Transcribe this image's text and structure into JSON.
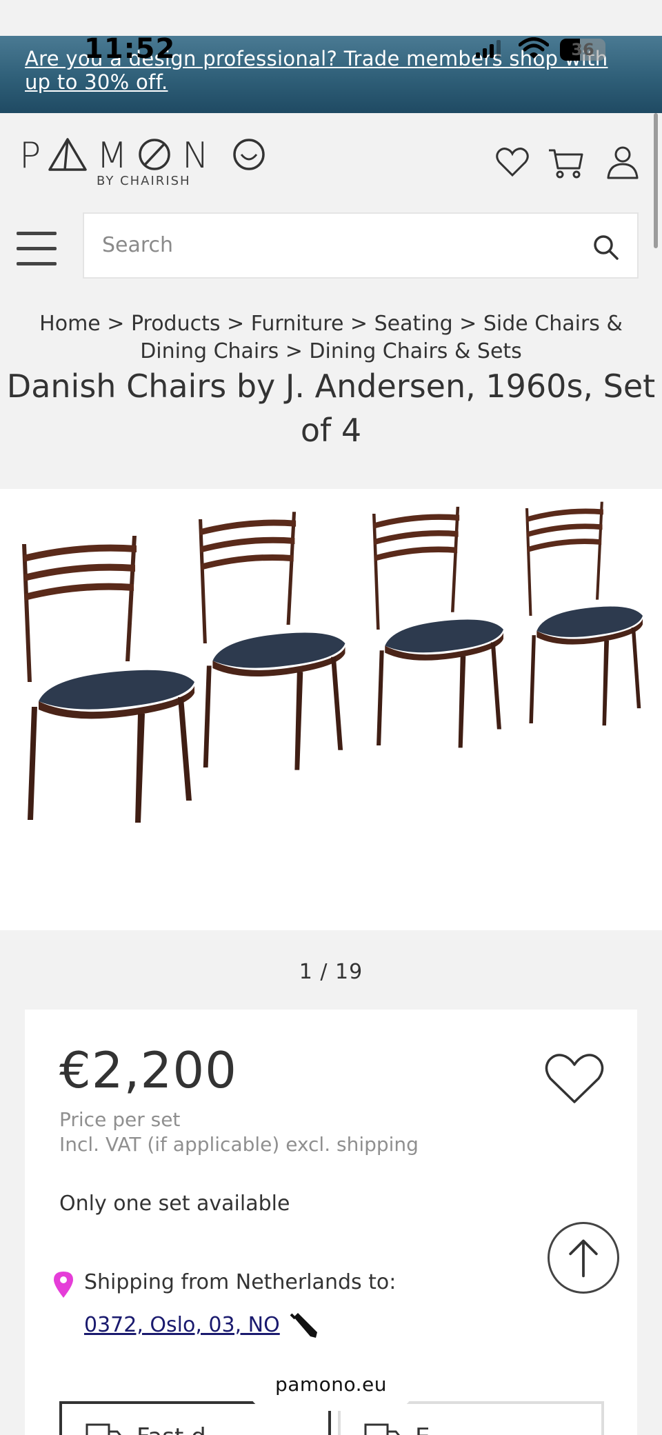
{
  "status_bar": {
    "time": "11:52",
    "battery": "36"
  },
  "banner": {
    "text": "Are you a design professional? Trade members shop with up to 30% off."
  },
  "header": {
    "logo_text": "PAMONO",
    "logo_sub": "BY CHAIRISH",
    "icons": [
      "heart-icon",
      "cart-icon",
      "user-icon"
    ]
  },
  "search": {
    "placeholder": "Search"
  },
  "breadcrumb": "Home > Products > Furniture > Seating > Side Chairs & Dining Chairs > Dining Chairs & Sets",
  "product": {
    "title": "Danish Chairs by J. Andersen, 1960s, Set of 4",
    "image_counter": "1 / 19",
    "price": "€2,200",
    "price_unit": "Price per set",
    "price_note": "Incl. VAT (if applicable) excl. shipping",
    "availability": "Only one set available",
    "shipping_from": "Shipping from Netherlands to:",
    "shipping_destination": "0372, Oslo, 03, NO",
    "delivery_option_1": "Fast d",
    "delivery_option_2": "E"
  },
  "browser": {
    "url": "pamono.eu"
  },
  "colors": {
    "banner_start": "#4a7a93",
    "banner_end": "#1f4a63",
    "pin": "#e53dd8",
    "link": "#1a1a6e",
    "chair_seat": "#2d3a4e",
    "chair_wood": "#4a2418"
  }
}
